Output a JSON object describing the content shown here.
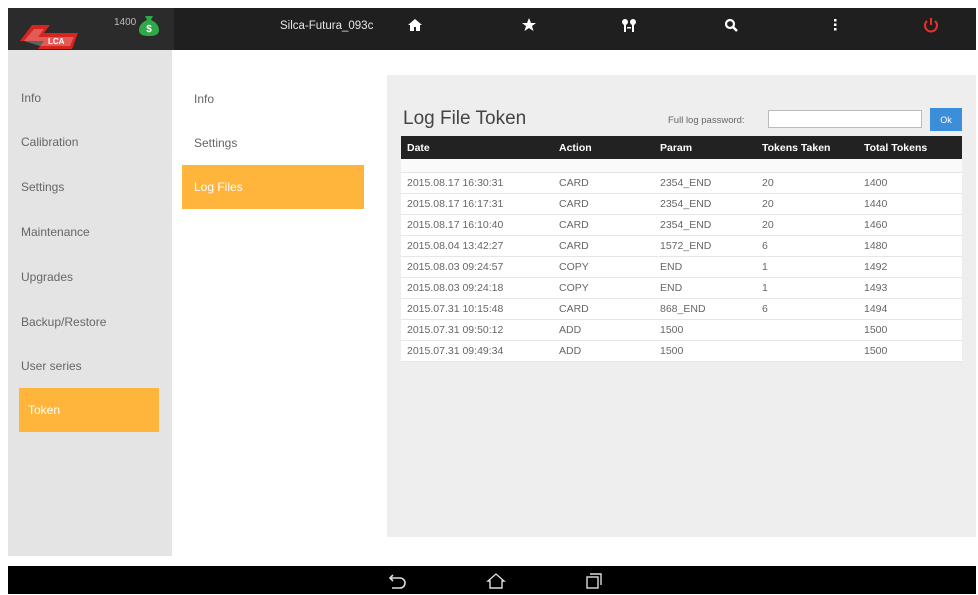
{
  "header": {
    "token_count": "1400",
    "device_name": "Silca-Futura_093c",
    "icons": [
      "home-icon",
      "star-icon",
      "keys-icon",
      "search-icon",
      "more-icon",
      "power-icon"
    ]
  },
  "left_menu": {
    "items": [
      "Info",
      "Calibration",
      "Settings",
      "Maintenance",
      "Upgrades",
      "Backup/Restore",
      "User series",
      "Token"
    ],
    "active": "Token"
  },
  "sub_menu": {
    "items": [
      "Info",
      "Settings",
      "Log Files"
    ],
    "active": "Log Files"
  },
  "panel": {
    "title": "Log File Token",
    "password_label": "Full log password:",
    "password_value": "",
    "ok_label": "Ok"
  },
  "table": {
    "columns": [
      "Date",
      "Action",
      "Param",
      "Tokens Taken",
      "Total Tokens"
    ],
    "rows": [
      [
        "2015.08.17 16:30:31",
        "CARD",
        "2354_END",
        "20",
        "1400"
      ],
      [
        "2015.08.17 16:17:31",
        "CARD",
        "2354_END",
        "20",
        "1440"
      ],
      [
        "2015.08.17 16:10:40",
        "CARD",
        "2354_END",
        "20",
        "1460"
      ],
      [
        "2015.08.04 13:42:27",
        "CARD",
        "1572_END",
        "6",
        "1480"
      ],
      [
        "2015.08.03 09:24:57",
        "COPY",
        "END",
        "1",
        "1492"
      ],
      [
        "2015.08.03 09:24:18",
        "COPY",
        "END",
        "1",
        "1493"
      ],
      [
        "2015.07.31 10:15:48",
        "CARD",
        "868_END",
        "6",
        "1494"
      ],
      [
        "2015.07.31 09:50:12",
        "ADD",
        "1500",
        "",
        "1500"
      ],
      [
        "2015.07.31 09:49:34",
        "ADD",
        "1500",
        "",
        "1500"
      ]
    ]
  },
  "colors": {
    "accent": "#ffb43c",
    "topbar": "#1f1f1f",
    "ok_button": "#3a8fd8",
    "power": "#e8302a",
    "money": "#2fa84a"
  },
  "navbar": {
    "icons": [
      "back-icon",
      "home-nav-icon",
      "recents-icon"
    ]
  }
}
